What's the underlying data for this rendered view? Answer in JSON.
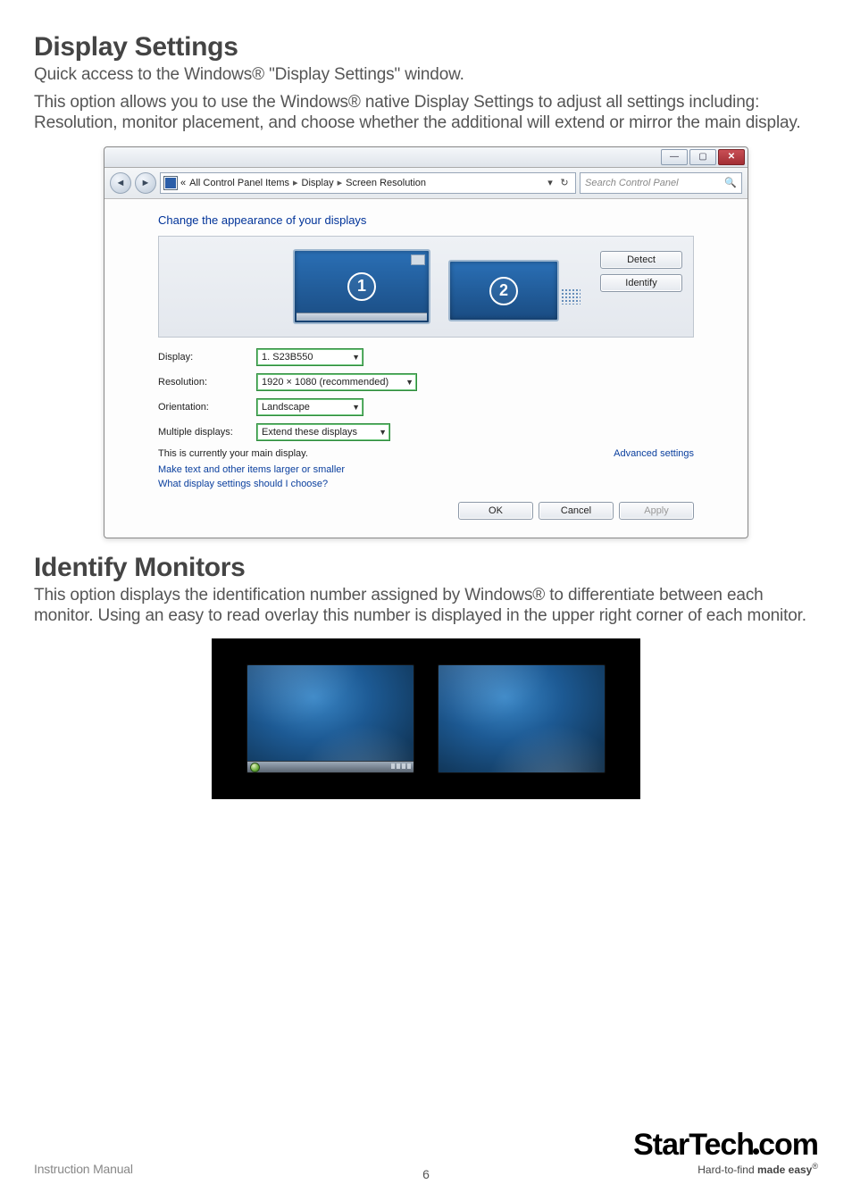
{
  "heading1": "Display Settings",
  "intro1": "Quick access to the Windows® \"Display Settings\" window.",
  "body1": "This option allows you to use the Windows® native Display Settings to adjust all settings including: Resolution, monitor placement, and choose whether the additional will extend or mirror the main display.",
  "heading2": "Identify Monitors",
  "body2": "This option displays the identification number assigned by Windows® to differentiate between each monitor.  Using an easy to read overlay this number is displayed in the upper right corner of each monitor.",
  "window": {
    "breadcrumb": {
      "prefix": "«",
      "items": [
        "All Control Panel Items",
        "Display",
        "Screen Resolution"
      ]
    },
    "search_placeholder": "Search Control Panel",
    "section_title": "Change the appearance of your displays",
    "detect_btn": "Detect",
    "identify_btn": "Identify",
    "mon1": "1",
    "mon2": "2",
    "labels": {
      "display": "Display:",
      "resolution": "Resolution:",
      "orientation": "Orientation:",
      "multiple": "Multiple displays:"
    },
    "values": {
      "display": "1. S23B550",
      "resolution": "1920 × 1080 (recommended)",
      "orientation": "Landscape",
      "multiple": "Extend these displays"
    },
    "main_display_note": "This is currently your main display.",
    "adv_link": "Advanced settings",
    "link1": "Make text and other items larger or smaller",
    "link2": "What display settings should I choose?",
    "ok": "OK",
    "cancel": "Cancel",
    "apply": "Apply"
  },
  "footer": {
    "label": "Instruction Manual",
    "page": "6",
    "brand": "StarTech",
    "brand_suffix": "com",
    "tagline_pre": "Hard-to-find ",
    "tagline_bold": "made easy"
  }
}
